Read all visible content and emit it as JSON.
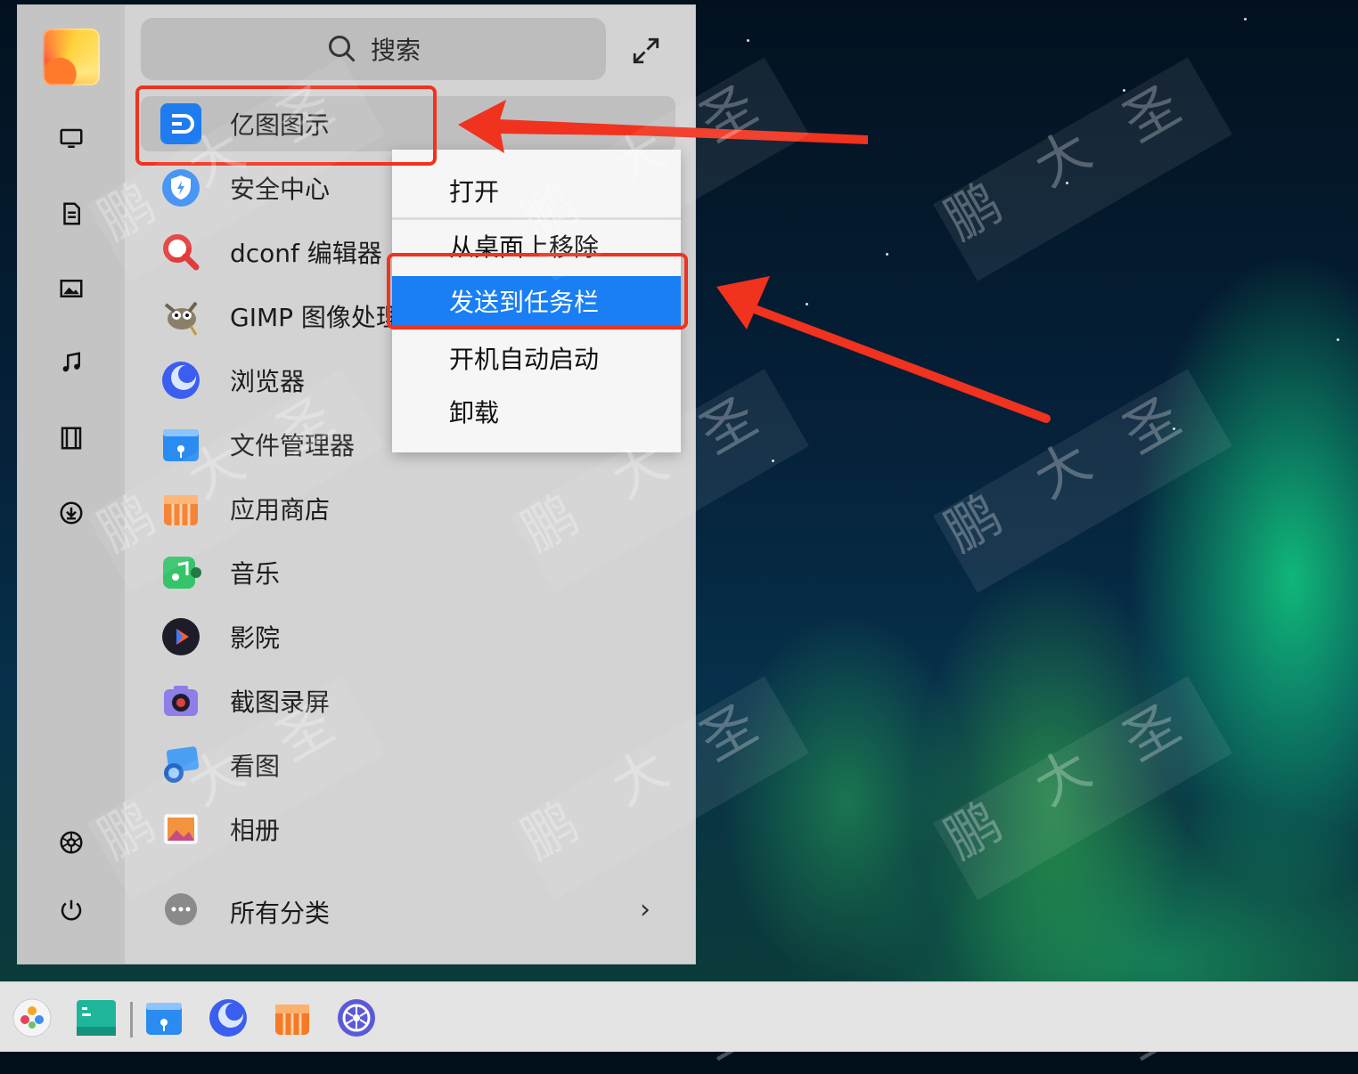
{
  "search": {
    "placeholder": "搜索"
  },
  "apps": [
    {
      "label": "亿图图示",
      "icon": "edraw-icon"
    },
    {
      "label": "安全中心",
      "icon": "shield-icon"
    },
    {
      "label": "dconf 编辑器",
      "icon": "magnifier-red-icon"
    },
    {
      "label": "GIMP 图像处理",
      "icon": "gimp-icon"
    },
    {
      "label": "浏览器",
      "icon": "browser-icon"
    },
    {
      "label": "文件管理器",
      "icon": "file-manager-icon"
    },
    {
      "label": "应用商店",
      "icon": "app-store-icon"
    },
    {
      "label": "音乐",
      "icon": "music-icon"
    },
    {
      "label": "影院",
      "icon": "movie-icon"
    },
    {
      "label": "截图录屏",
      "icon": "screenshot-icon"
    },
    {
      "label": "看图",
      "icon": "image-viewer-icon"
    },
    {
      "label": "相册",
      "icon": "album-icon"
    }
  ],
  "all_categories": {
    "label": "所有分类",
    "chevron": "›"
  },
  "context_menu": {
    "items": [
      {
        "label": "打开"
      },
      {
        "label": "从桌面上移除"
      },
      {
        "label": "发送到任务栏"
      },
      {
        "label": "开机自动启动"
      },
      {
        "label": "卸载"
      }
    ],
    "active_index": 2
  },
  "sidebar": {
    "items": [
      "computer-icon",
      "document-icon",
      "pictures-icon",
      "music-note-icon",
      "video-icon",
      "download-icon",
      "settings-icon",
      "power-icon"
    ]
  },
  "taskbar": {
    "items": [
      "launcher-icon",
      "desktop-icon",
      "file-manager-icon",
      "browser-icon",
      "app-store-icon",
      "control-center-icon"
    ]
  },
  "watermark": {
    "chars": [
      "鹏",
      "大",
      "圣"
    ]
  },
  "colors": {
    "highlight": "#1a7ff5",
    "annotation": "#f0321e"
  }
}
